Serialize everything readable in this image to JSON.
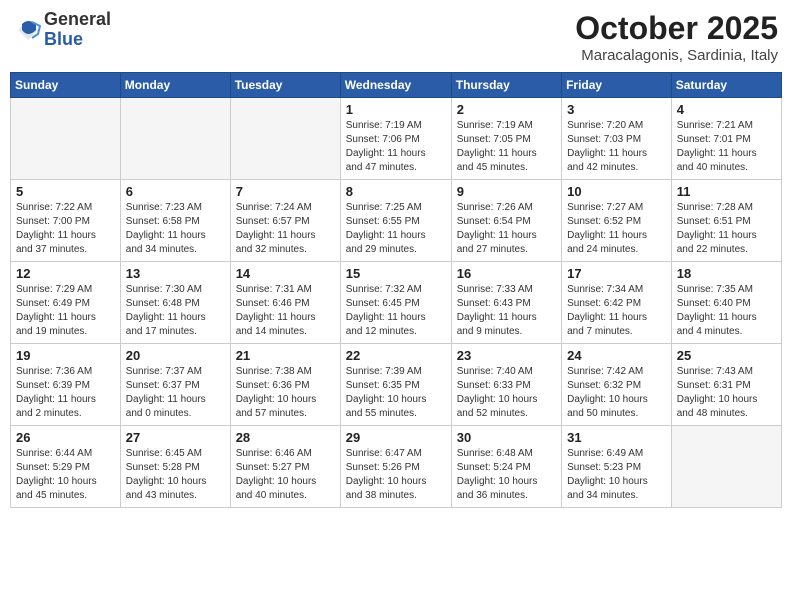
{
  "logo": {
    "general": "General",
    "blue": "Blue"
  },
  "title": "October 2025",
  "location": "Maracalagonis, Sardinia, Italy",
  "weekdays": [
    "Sunday",
    "Monday",
    "Tuesday",
    "Wednesday",
    "Thursday",
    "Friday",
    "Saturday"
  ],
  "weeks": [
    [
      {
        "day": "",
        "info": ""
      },
      {
        "day": "",
        "info": ""
      },
      {
        "day": "",
        "info": ""
      },
      {
        "day": "1",
        "info": "Sunrise: 7:19 AM\nSunset: 7:06 PM\nDaylight: 11 hours\nand 47 minutes."
      },
      {
        "day": "2",
        "info": "Sunrise: 7:19 AM\nSunset: 7:05 PM\nDaylight: 11 hours\nand 45 minutes."
      },
      {
        "day": "3",
        "info": "Sunrise: 7:20 AM\nSunset: 7:03 PM\nDaylight: 11 hours\nand 42 minutes."
      },
      {
        "day": "4",
        "info": "Sunrise: 7:21 AM\nSunset: 7:01 PM\nDaylight: 11 hours\nand 40 minutes."
      }
    ],
    [
      {
        "day": "5",
        "info": "Sunrise: 7:22 AM\nSunset: 7:00 PM\nDaylight: 11 hours\nand 37 minutes."
      },
      {
        "day": "6",
        "info": "Sunrise: 7:23 AM\nSunset: 6:58 PM\nDaylight: 11 hours\nand 34 minutes."
      },
      {
        "day": "7",
        "info": "Sunrise: 7:24 AM\nSunset: 6:57 PM\nDaylight: 11 hours\nand 32 minutes."
      },
      {
        "day": "8",
        "info": "Sunrise: 7:25 AM\nSunset: 6:55 PM\nDaylight: 11 hours\nand 29 minutes."
      },
      {
        "day": "9",
        "info": "Sunrise: 7:26 AM\nSunset: 6:54 PM\nDaylight: 11 hours\nand 27 minutes."
      },
      {
        "day": "10",
        "info": "Sunrise: 7:27 AM\nSunset: 6:52 PM\nDaylight: 11 hours\nand 24 minutes."
      },
      {
        "day": "11",
        "info": "Sunrise: 7:28 AM\nSunset: 6:51 PM\nDaylight: 11 hours\nand 22 minutes."
      }
    ],
    [
      {
        "day": "12",
        "info": "Sunrise: 7:29 AM\nSunset: 6:49 PM\nDaylight: 11 hours\nand 19 minutes."
      },
      {
        "day": "13",
        "info": "Sunrise: 7:30 AM\nSunset: 6:48 PM\nDaylight: 11 hours\nand 17 minutes."
      },
      {
        "day": "14",
        "info": "Sunrise: 7:31 AM\nSunset: 6:46 PM\nDaylight: 11 hours\nand 14 minutes."
      },
      {
        "day": "15",
        "info": "Sunrise: 7:32 AM\nSunset: 6:45 PM\nDaylight: 11 hours\nand 12 minutes."
      },
      {
        "day": "16",
        "info": "Sunrise: 7:33 AM\nSunset: 6:43 PM\nDaylight: 11 hours\nand 9 minutes."
      },
      {
        "day": "17",
        "info": "Sunrise: 7:34 AM\nSunset: 6:42 PM\nDaylight: 11 hours\nand 7 minutes."
      },
      {
        "day": "18",
        "info": "Sunrise: 7:35 AM\nSunset: 6:40 PM\nDaylight: 11 hours\nand 4 minutes."
      }
    ],
    [
      {
        "day": "19",
        "info": "Sunrise: 7:36 AM\nSunset: 6:39 PM\nDaylight: 11 hours\nand 2 minutes."
      },
      {
        "day": "20",
        "info": "Sunrise: 7:37 AM\nSunset: 6:37 PM\nDaylight: 11 hours\nand 0 minutes."
      },
      {
        "day": "21",
        "info": "Sunrise: 7:38 AM\nSunset: 6:36 PM\nDaylight: 10 hours\nand 57 minutes."
      },
      {
        "day": "22",
        "info": "Sunrise: 7:39 AM\nSunset: 6:35 PM\nDaylight: 10 hours\nand 55 minutes."
      },
      {
        "day": "23",
        "info": "Sunrise: 7:40 AM\nSunset: 6:33 PM\nDaylight: 10 hours\nand 52 minutes."
      },
      {
        "day": "24",
        "info": "Sunrise: 7:42 AM\nSunset: 6:32 PM\nDaylight: 10 hours\nand 50 minutes."
      },
      {
        "day": "25",
        "info": "Sunrise: 7:43 AM\nSunset: 6:31 PM\nDaylight: 10 hours\nand 48 minutes."
      }
    ],
    [
      {
        "day": "26",
        "info": "Sunrise: 6:44 AM\nSunset: 5:29 PM\nDaylight: 10 hours\nand 45 minutes."
      },
      {
        "day": "27",
        "info": "Sunrise: 6:45 AM\nSunset: 5:28 PM\nDaylight: 10 hours\nand 43 minutes."
      },
      {
        "day": "28",
        "info": "Sunrise: 6:46 AM\nSunset: 5:27 PM\nDaylight: 10 hours\nand 40 minutes."
      },
      {
        "day": "29",
        "info": "Sunrise: 6:47 AM\nSunset: 5:26 PM\nDaylight: 10 hours\nand 38 minutes."
      },
      {
        "day": "30",
        "info": "Sunrise: 6:48 AM\nSunset: 5:24 PM\nDaylight: 10 hours\nand 36 minutes."
      },
      {
        "day": "31",
        "info": "Sunrise: 6:49 AM\nSunset: 5:23 PM\nDaylight: 10 hours\nand 34 minutes."
      },
      {
        "day": "",
        "info": ""
      }
    ]
  ]
}
